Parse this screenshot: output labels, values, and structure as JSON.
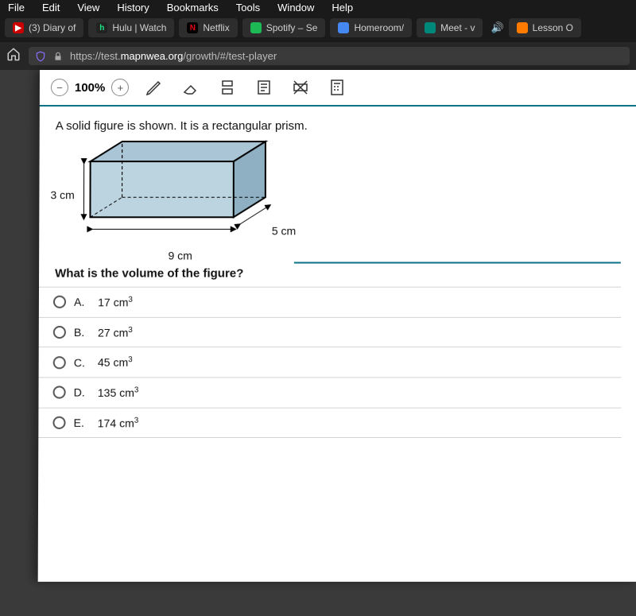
{
  "menubar": [
    "File",
    "Edit",
    "View",
    "History",
    "Bookmarks",
    "Tools",
    "Window",
    "Help"
  ],
  "tabs": [
    {
      "fav_bg": "#cc0000",
      "fav_txt": "▶",
      "label": "(3) Diary of"
    },
    {
      "fav_bg": "#3a3a3a",
      "fav_txt": "h",
      "label": "Hulu | Watch"
    },
    {
      "fav_bg": "#000",
      "fav_txt": "N",
      "label": "Netflix",
      "fav_color": "#e50914"
    },
    {
      "fav_bg": "#1db954",
      "fav_txt": "",
      "label": "Spotify – Se"
    },
    {
      "fav_bg": "#4688f1",
      "fav_txt": "",
      "label": "Homeroom/"
    },
    {
      "fav_bg": "#333",
      "fav_txt": "",
      "label": "Meet - v"
    },
    {
      "fav_bg": "#ff7b00",
      "fav_txt": "",
      "label": "Lesson O"
    }
  ],
  "url": {
    "prefix": "https://test.",
    "host": "mapnwea.org",
    "path": "/growth/#/test-player"
  },
  "toolbar": {
    "zoom": "100%"
  },
  "question": {
    "prompt": "A solid figure is shown. It is a rectangular prism.",
    "dim_h": "3 cm",
    "dim_w": "9 cm",
    "dim_d": "5 cm",
    "ask": "What is the volume of the figure?"
  },
  "options": [
    {
      "letter": "A.",
      "value": "17 cm",
      "exp": "3"
    },
    {
      "letter": "B.",
      "value": "27 cm",
      "exp": "3"
    },
    {
      "letter": "C.",
      "value": "45 cm",
      "exp": "3"
    },
    {
      "letter": "D.",
      "value": "135 cm",
      "exp": "3"
    },
    {
      "letter": "E.",
      "value": "174 cm",
      "exp": "3"
    }
  ]
}
